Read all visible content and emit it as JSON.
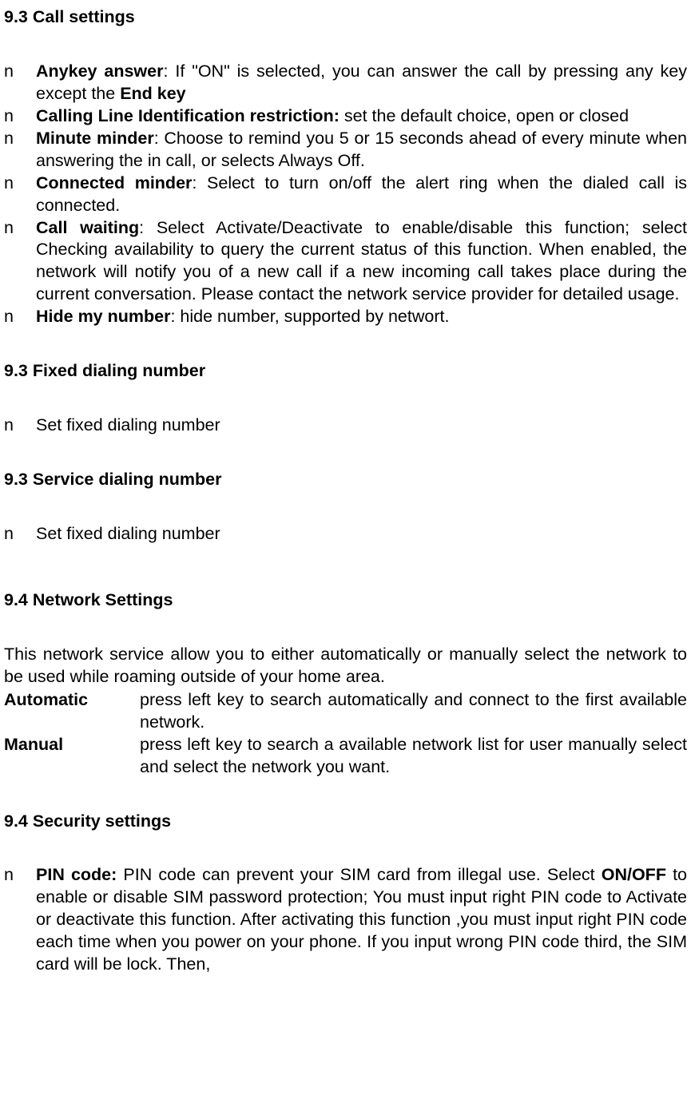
{
  "s1": {
    "title": "9.3 Call settings",
    "items": [
      {
        "marker": "n",
        "bold": "Anykey answer",
        "sep": ": ",
        "text1": "If \"ON\" is selected, you can answer the call by pressing any key except the ",
        "bold2": "End key",
        "text2": ""
      },
      {
        "marker": "n",
        "bold": "Calling Line Identification restriction:",
        "sep": " ",
        "text1": "set the default choice, open or closed"
      },
      {
        "marker": "n",
        "bold": "Minute minder",
        "sep": ": ",
        "text1": "Choose to remind you 5 or 15 seconds ahead of every minute when answering the in call, or selects Always Off."
      },
      {
        "marker": "n",
        "bold": "Connected minder",
        "sep": ": ",
        "text1": "Select to turn on/off the alert ring when the dialed call is connected."
      },
      {
        "marker": "n",
        "bold": "Call waiting",
        "sep": ": ",
        "text1": "Select Activate/Deactivate to enable/disable this function; select Checking availability to query the current status of this function. When enabled, the network will notify you of a new call if a new incoming call takes place during the current conversation. Please contact the network service provider for detailed usage."
      },
      {
        "marker": "n",
        "bold": "Hide my number",
        "sep": ": ",
        "text1": "hide number, supported by networt."
      }
    ]
  },
  "s2": {
    "title": "9.3 Fixed dialing number",
    "items": [
      {
        "marker": "n",
        "text": "Set fixed dialing number"
      }
    ]
  },
  "s3": {
    "title": "9.3 Service dialing number",
    "items": [
      {
        "marker": "n",
        "text": "Set fixed dialing number"
      }
    ]
  },
  "s4": {
    "title": "9.4 Network Settings",
    "intro": "This network service allow you to either automatically or manually select the network to be used while roaming outside of your home area.",
    "defs": [
      {
        "label": "Automatic",
        "value": "press left key to search automatically and connect to the first available network."
      },
      {
        "label": "Manual",
        "value": "press left key to search a available network list for user manually select and select the network you want."
      }
    ]
  },
  "s5": {
    "title": "9.4 Security settings",
    "items": [
      {
        "marker": "n",
        "bold": "PIN code:",
        "sep": " ",
        "text1": "PIN code can prevent your SIM card from illegal use. Select ",
        "bold2": "ON/OFF",
        "text2": " to enable or disable SIM password protection; You must input right PIN code to Activate or deactivate this function. After activating this function ,you must input right PIN code each time when you power on your phone. If you input wrong PIN code third, the SIM card will be lock. Then,"
      }
    ]
  }
}
